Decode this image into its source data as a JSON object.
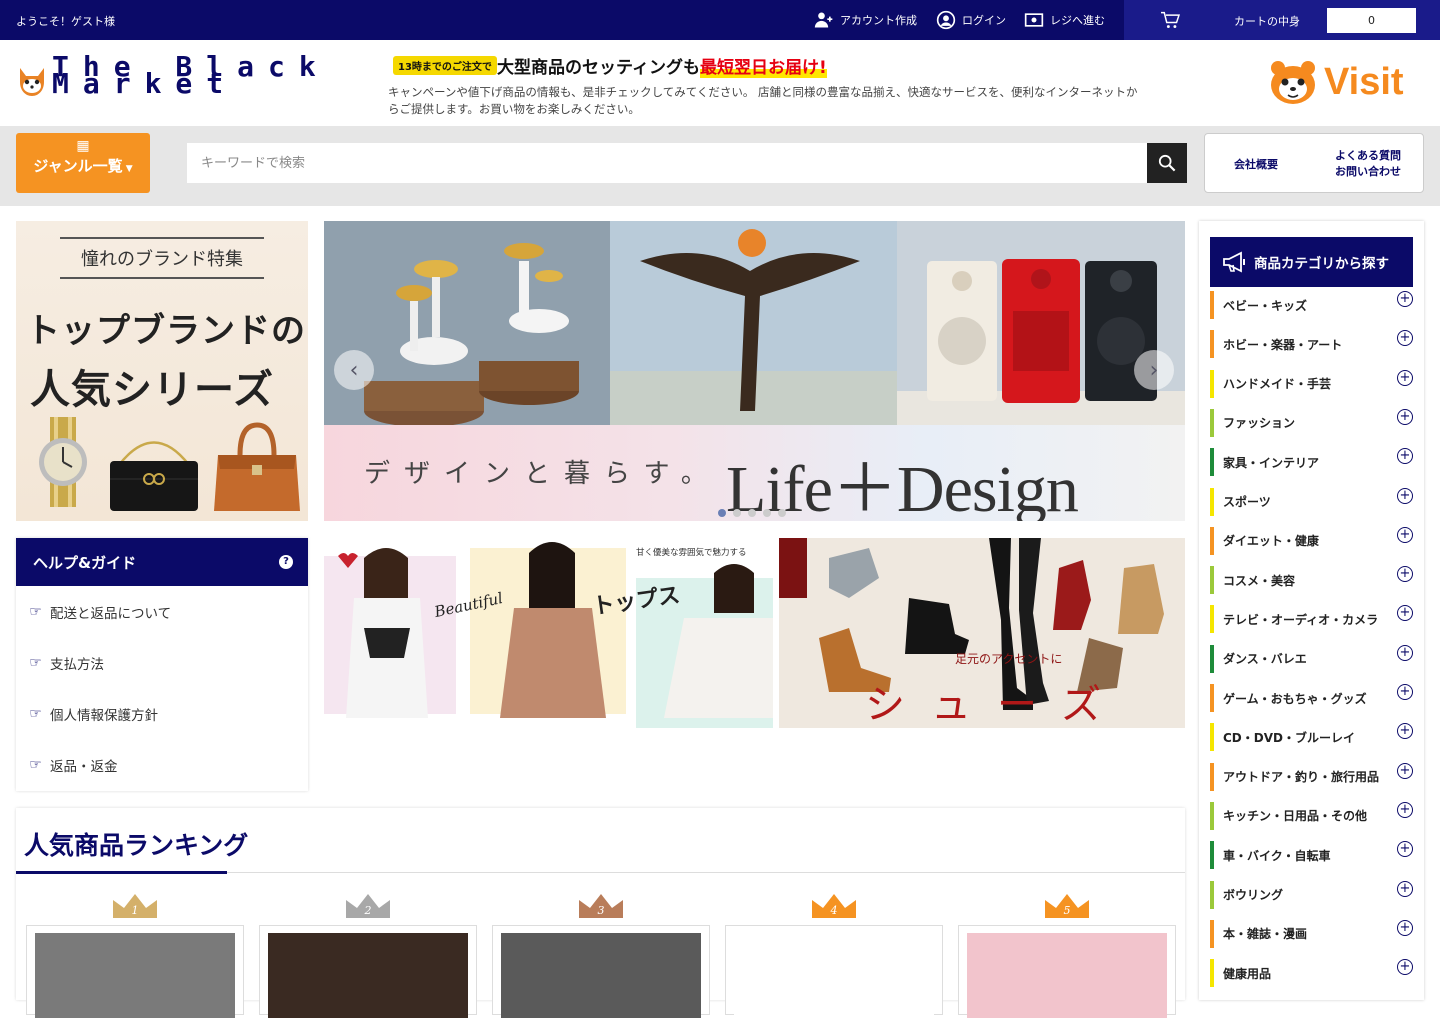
{
  "topbar": {
    "welcome": "ようこそ！ゲスト様",
    "links": [
      {
        "label": "アカウント作成",
        "icon": "user-plus-icon"
      },
      {
        "label": "ログイン",
        "icon": "user-circle-icon"
      },
      {
        "label": "レジへ進む",
        "icon": "money-icon"
      }
    ],
    "cart_label": "カートの中身",
    "cart_count": "0"
  },
  "header": {
    "logo_text": "The Black Market",
    "promo_badge": "13時までのご注文で",
    "promo_main": "大型商品のセッティングも",
    "promo_highlight": "最短翌日お届け!",
    "promo_desc": "キャンペーンや値下げ商品の情報も、是非チェックしてみてください。 店舗と同様の豊富な品揃え、快適なサービスを、便利なインターネットからご提供します。お買い物をお楽しみください。",
    "visit_label": "Visit"
  },
  "search": {
    "genre_label": "ジャンル一覧",
    "placeholder": "キーワードで検索",
    "company_link": "会社概要",
    "faq_link_1": "よくある質問",
    "faq_link_2": "お問い合わせ"
  },
  "brand_banner": {
    "title": "憧れのブランド特集",
    "line1": "トップブランドの",
    "line2": "人気シリーズ"
  },
  "slider": {
    "subtitle": "デザインと暮らす。",
    "title": "Life＋Design",
    "dot_count": 5,
    "active_dot": 0
  },
  "fashion_banner": {
    "script": "Beautiful",
    "title": "トップス",
    "caption": "甘く優美な雰囲気で魅力する"
  },
  "shoes_banner": {
    "caption": "足元のアクセントに",
    "title": "シューズ"
  },
  "help": {
    "title": "ヘルプ&ガイド",
    "items": [
      "配送と返品について",
      "支払方法",
      "個人情報保護方針",
      "返品・返金"
    ]
  },
  "ranking": {
    "title": "人気商品ランキング",
    "ranks": [
      {
        "num": "1",
        "color": "#d4b06a"
      },
      {
        "num": "2",
        "color": "#a8a8a8"
      },
      {
        "num": "3",
        "color": "#b97d5a"
      },
      {
        "num": "4",
        "color": "#f59322"
      },
      {
        "num": "5",
        "color": "#f59322"
      }
    ]
  },
  "categories": {
    "title": "商品カテゴリから探す",
    "items": [
      {
        "label": "ベビー・キッズ",
        "color": "#f59322"
      },
      {
        "label": "ホビー・楽器・アート",
        "color": "#f59322"
      },
      {
        "label": "ハンドメイド・手芸",
        "color": "#f5e600"
      },
      {
        "label": "ファッション",
        "color": "#9bc93a"
      },
      {
        "label": "家具・インテリア",
        "color": "#1e8c3a"
      },
      {
        "label": "スポーツ",
        "color": "#f5e600"
      },
      {
        "label": "ダイエット・健康",
        "color": "#f59322"
      },
      {
        "label": "コスメ・美容",
        "color": "#9bc93a"
      },
      {
        "label": "テレビ・オーディオ・カメラ",
        "color": "#f5e600"
      },
      {
        "label": "ダンス・バレエ",
        "color": "#1e8c3a"
      },
      {
        "label": "ゲーム・おもちゃ・グッズ",
        "color": "#f59322"
      },
      {
        "label": "CD・DVD・ブルーレイ",
        "color": "#f5e600"
      },
      {
        "label": "アウトドア・釣り・旅行用品",
        "color": "#f59322"
      },
      {
        "label": "キッチン・日用品・その他",
        "color": "#9bc93a"
      },
      {
        "label": "車・バイク・自転車",
        "color": "#1e8c3a"
      },
      {
        "label": "ボウリング",
        "color": "#9bc93a"
      },
      {
        "label": "本・雑誌・漫画",
        "color": "#f59322"
      },
      {
        "label": "健康用品",
        "color": "#f5e600"
      }
    ]
  }
}
